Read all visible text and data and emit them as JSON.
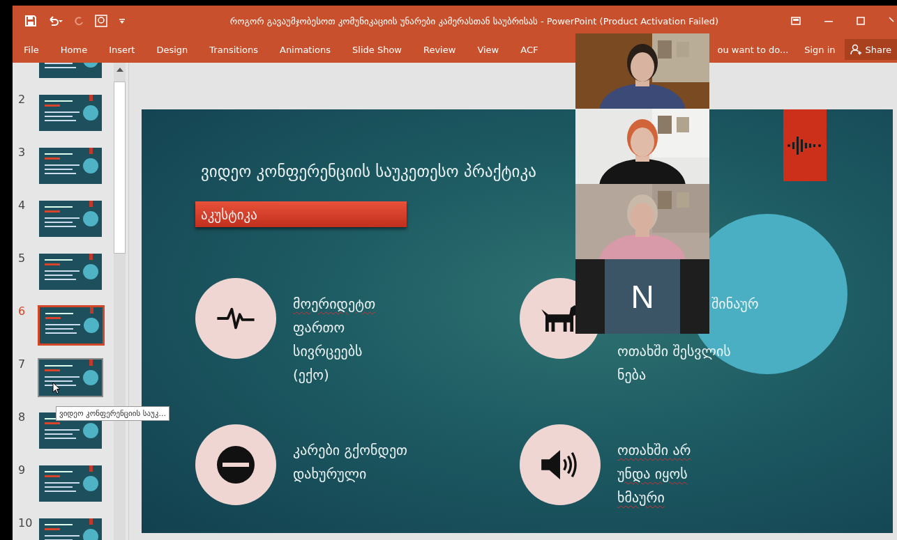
{
  "window": {
    "title": "როგორ გავაუმჯობესოთ კომუნიკაციის უნარები კამერასთან საუბრისას - PowerPoint (Product Activation Failed)"
  },
  "ribbon": {
    "tabs": [
      {
        "label": "File",
        "selected": false
      },
      {
        "label": "Home",
        "selected": false
      },
      {
        "label": "Insert",
        "selected": false
      },
      {
        "label": "Design",
        "selected": false
      },
      {
        "label": "Transitions",
        "selected": false
      },
      {
        "label": "Animations",
        "selected": false
      },
      {
        "label": "Slide Show",
        "selected": false
      },
      {
        "label": "Review",
        "selected": false
      },
      {
        "label": "View",
        "selected": false
      },
      {
        "label": "ACF",
        "selected": false
      }
    ],
    "tell_me": "ou want to do...",
    "sign_in": "Sign in",
    "share": "Share"
  },
  "thumbnails": [
    {
      "selected": false,
      "hovered": false
    },
    {
      "number": "2",
      "selected": false,
      "hovered": false
    },
    {
      "number": "3",
      "selected": false,
      "hovered": false
    },
    {
      "number": "4",
      "selected": false,
      "hovered": false
    },
    {
      "number": "5",
      "selected": false,
      "hovered": false
    },
    {
      "number": "6",
      "selected": true,
      "hovered": false
    },
    {
      "number": "7",
      "selected": false,
      "hovered": true
    },
    {
      "number": "8",
      "selected": false,
      "hovered": false
    },
    {
      "number": "9",
      "selected": false,
      "hovered": false
    },
    {
      "number": "10",
      "selected": false,
      "hovered": false
    }
  ],
  "tooltip": "ვიდეო კონფერენციის საუკ...",
  "slide": {
    "title": "ვიდეო კონფერენციის საუკეთესო პრაქტიკა",
    "section": "აკუსტიკა",
    "items": [
      {
        "kind": "pulse",
        "lines": [
          {
            "text": "მოერიდეტთ",
            "misspelled": true
          },
          {
            "text": "ფართო",
            "misspelled": false
          },
          {
            "text": "სივრცეებს",
            "misspelled": false
          },
          {
            "text": "(ექო)",
            "misspelled": false
          }
        ]
      },
      {
        "kind": "dog",
        "lines": [
          {
            "text": "შინაურ",
            "misspelled": false,
            "clipped": true
          },
          {
            "text": "ოთახში შესვლის",
            "misspelled": false
          },
          {
            "text": "ნება",
            "misspelled": false
          }
        ]
      },
      {
        "kind": "no-entry",
        "lines": [
          {
            "text": "კარები გქონდეთ",
            "misspelled": false
          },
          {
            "text": "დახურული",
            "misspelled": false
          }
        ]
      },
      {
        "kind": "speaker",
        "lines": [
          {
            "text": "ოთახში არ",
            "misspelled": true
          },
          {
            "text": "უნდა იყოს",
            "misspelled": true
          },
          {
            "text": "ხმაური",
            "misspelled": true
          }
        ]
      }
    ]
  },
  "video_call": {
    "tiles": [
      {
        "kind": "picture"
      },
      {
        "kind": "picture"
      },
      {
        "kind": "picture"
      },
      {
        "kind": "initial",
        "initial": "N"
      }
    ]
  }
}
